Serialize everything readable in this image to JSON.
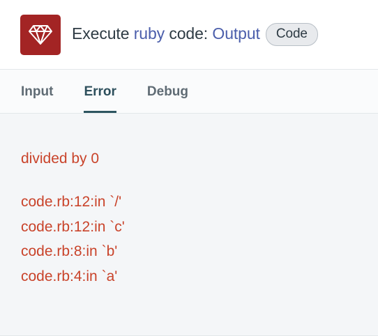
{
  "header": {
    "logo_icon": "ruby-gem-icon",
    "logo_color": "#a32424",
    "title_prefix": "Execute ",
    "title_link_1": "ruby",
    "title_middle": " code: ",
    "title_link_2": "Output",
    "badge": "Code"
  },
  "tabs": [
    {
      "label": "Input",
      "active": false
    },
    {
      "label": "Error",
      "active": true
    },
    {
      "label": "Debug",
      "active": false
    }
  ],
  "error": {
    "message": "divided by 0",
    "backtrace": [
      "code.rb:12:in `/'",
      "code.rb:12:in `c'",
      "code.rb:8:in `b'",
      "code.rb:4:in `a'"
    ]
  },
  "colors": {
    "error_text": "#c9432a",
    "link": "#4b5eab",
    "active_tab_underline": "#2d5560"
  }
}
